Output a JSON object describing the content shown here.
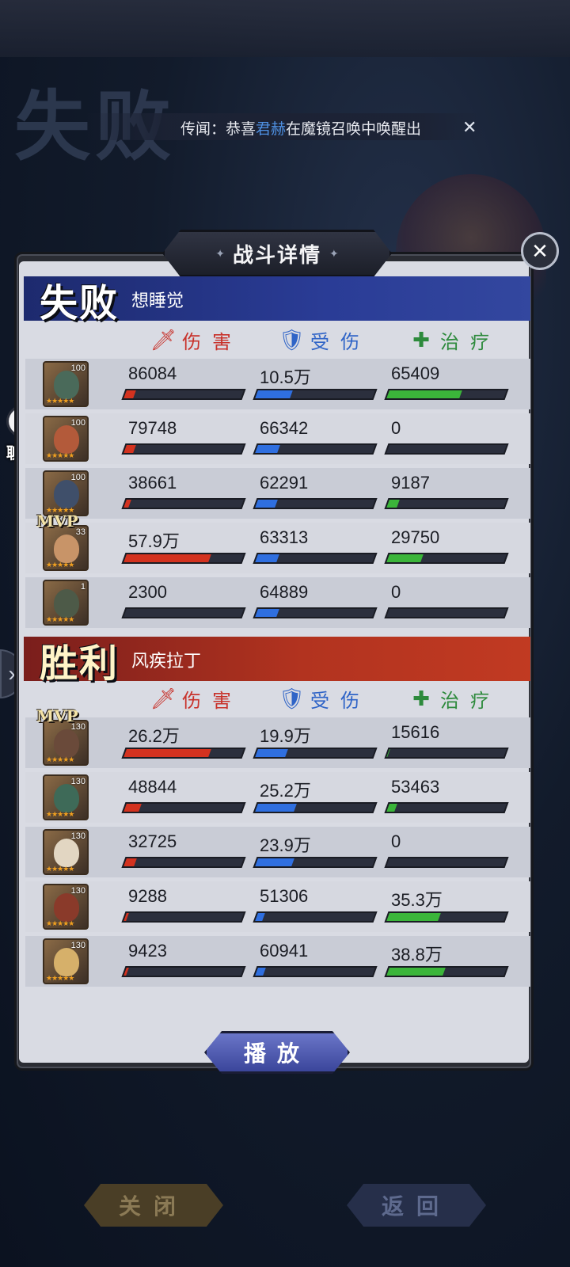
{
  "background": {
    "title": "失败"
  },
  "rumor": {
    "prefix": "传闻：恭喜",
    "highlight": "君赫",
    "suffix": "在魔镜召唤中唤醒出",
    "close": "✕"
  },
  "chat": {
    "label": "聊 天",
    "icon": "chat-bubble-icon"
  },
  "panel": {
    "title": "战斗详情",
    "close": "✕"
  },
  "columns": {
    "damage": "伤害",
    "taken": "受伤",
    "heal": "治疗"
  },
  "colors": {
    "damage": "#c8322b",
    "taken": "#2f64c7",
    "heal": "#2d8a3c",
    "lose_banner": "#2a3c96",
    "win_banner": "#b2331f"
  },
  "teams": [
    {
      "verdict": "失败",
      "name": "想睡觉",
      "rows": [
        {
          "level": "100",
          "mvp": "",
          "damage": "86084",
          "damage_pct": 0.08,
          "taken": "10.5万",
          "taken_pct": 0.3,
          "heal": "65409",
          "heal_pct": 0.62
        },
        {
          "level": "100",
          "mvp": "",
          "damage": "79748",
          "damage_pct": 0.08,
          "taken": "66342",
          "taken_pct": 0.19,
          "heal": "0",
          "heal_pct": 0.0
        },
        {
          "level": "100",
          "mvp": "",
          "damage": "38661",
          "damage_pct": 0.04,
          "taken": "62291",
          "taken_pct": 0.17,
          "heal": "9187",
          "heal_pct": 0.09
        },
        {
          "level": "33",
          "mvp": "MVP",
          "damage": "57.9万",
          "damage_pct": 0.72,
          "taken": "63313",
          "taken_pct": 0.18,
          "heal": "29750",
          "heal_pct": 0.29
        },
        {
          "level": "1",
          "mvp": "",
          "damage": "2300",
          "damage_pct": 0.0,
          "taken": "64889",
          "taken_pct": 0.18,
          "heal": "0",
          "heal_pct": 0.0
        }
      ]
    },
    {
      "verdict": "胜利",
      "name": "风疾拉丁",
      "rows": [
        {
          "level": "130",
          "mvp": "MVP",
          "damage": "26.2万",
          "damage_pct": 0.72,
          "taken": "19.9万",
          "taken_pct": 0.26,
          "heal": "15616",
          "heal_pct": 0.01
        },
        {
          "level": "130",
          "mvp": "",
          "damage": "48844",
          "damage_pct": 0.13,
          "taken": "25.2万",
          "taken_pct": 0.33,
          "heal": "53463",
          "heal_pct": 0.07
        },
        {
          "level": "130",
          "mvp": "",
          "damage": "32725",
          "damage_pct": 0.09,
          "taken": "23.9万",
          "taken_pct": 0.31,
          "heal": "0",
          "heal_pct": 0.0
        },
        {
          "level": "130",
          "mvp": "",
          "damage": "9288",
          "damage_pct": 0.02,
          "taken": "51306",
          "taken_pct": 0.06,
          "heal": "35.3万",
          "heal_pct": 0.44
        },
        {
          "level": "130",
          "mvp": "",
          "damage": "9423",
          "damage_pct": 0.02,
          "taken": "60941",
          "taken_pct": 0.07,
          "heal": "38.8万",
          "heal_pct": 0.48
        }
      ]
    }
  ],
  "buttons": {
    "play": "播放",
    "close": "关闭",
    "back": "返回"
  }
}
